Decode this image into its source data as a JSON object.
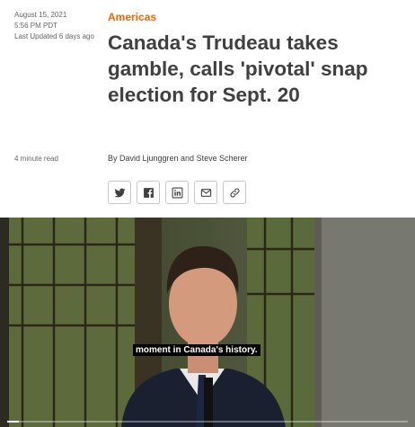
{
  "article": {
    "date": "August 15, 2021",
    "time": "5:56 PM PDT",
    "last_updated": "Last Updated 6 days ago",
    "category": "Americas",
    "headline": "Canada's Trudeau takes gamble, calls 'pivotal' snap election for Sept. 20",
    "read_time": "4 minute read",
    "byline": "By David Ljunggren and Steve Scherer"
  },
  "share": {
    "buttons": [
      "twitter-icon",
      "facebook-icon",
      "linkedin-icon",
      "email-icon",
      "link-icon"
    ],
    "border_color": "#c8c8c8",
    "icon_color": "#404040"
  },
  "video": {
    "caption": "moment in Canada's history.",
    "progress_fraction": 0.03
  },
  "colors": {
    "accent": "#fa6400",
    "headline": "#404040",
    "meta": "#666666"
  }
}
